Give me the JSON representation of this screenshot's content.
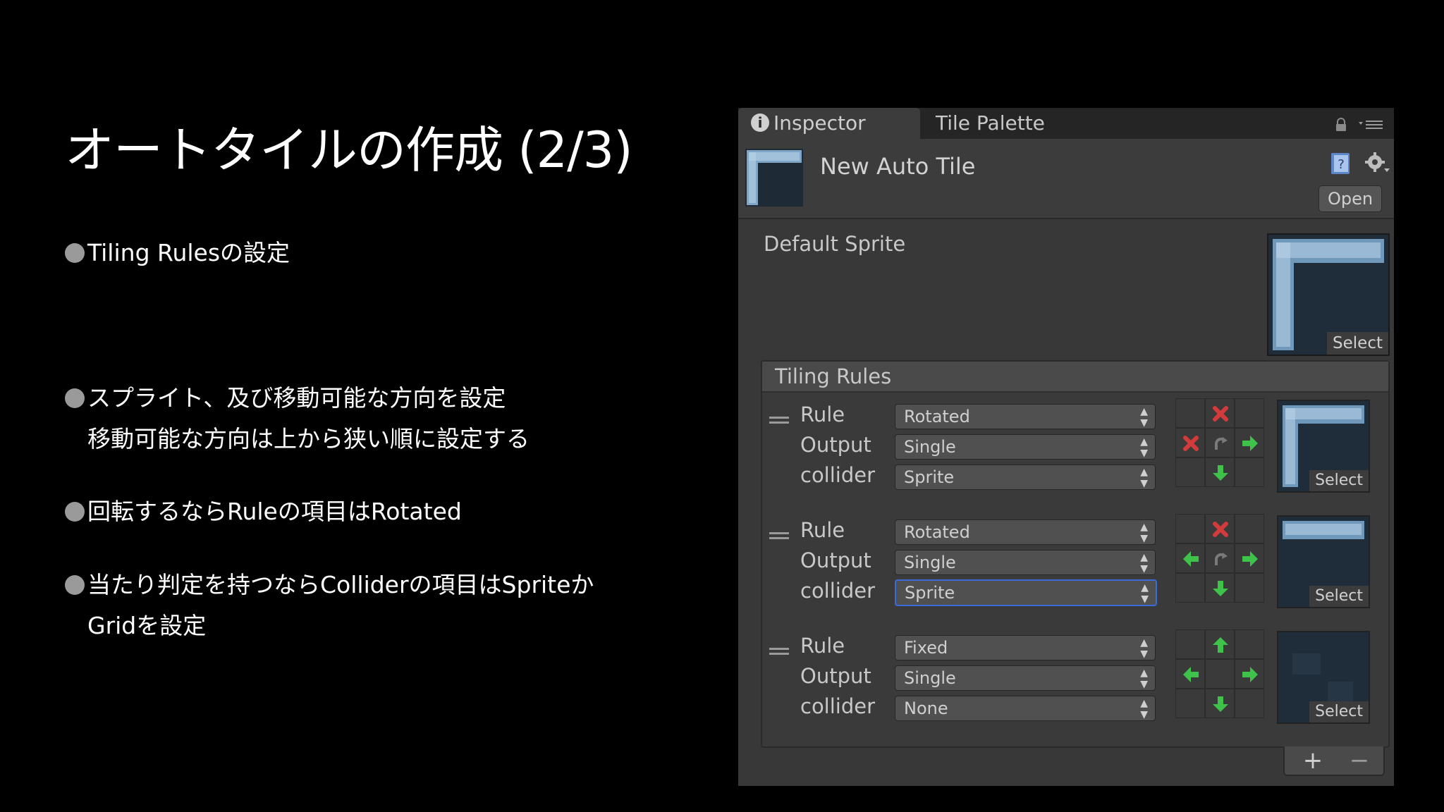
{
  "slide": {
    "title": "オートタイルの作成 (2/3)",
    "bullets": [
      {
        "line1": "Tiling Rulesの設定",
        "line2": ""
      },
      {
        "line1": "スプライト、及び移動可能な方向を設定",
        "line2": "移動可能な方向は上から狭い順に設定する"
      },
      {
        "line1": "回転するならRuleの項目はRotated",
        "line2": ""
      },
      {
        "line1": "当たり判定を持つならColliderの項目はSpriteか",
        "line2": "Gridを設定"
      }
    ]
  },
  "inspector": {
    "tabs": {
      "inspector": "Inspector",
      "tile_palette": "Tile Palette"
    },
    "asset_name": "New Auto Tile",
    "open_label": "Open",
    "default_sprite_label": "Default Sprite",
    "select_label": "Select",
    "tiling_rules_label": "Tiling Rules",
    "field_labels": {
      "rule": "Rule",
      "output": "Output",
      "collider": "collider"
    },
    "rules": [
      {
        "rule": "Rotated",
        "output": "Single",
        "collider": "Sprite",
        "collider_focused": false,
        "neighbors": [
          "",
          "x",
          "",
          "x",
          "rotate",
          "right",
          "",
          "down",
          ""
        ],
        "sprite": "corner"
      },
      {
        "rule": "Rotated",
        "output": "Single",
        "collider": "Sprite",
        "collider_focused": true,
        "neighbors": [
          "",
          "x",
          "",
          "left",
          "rotate",
          "right",
          "",
          "down",
          ""
        ],
        "sprite": "top"
      },
      {
        "rule": "Fixed",
        "output": "Single",
        "collider": "None",
        "collider_focused": false,
        "neighbors": [
          "",
          "up",
          "",
          "left",
          "",
          "right",
          "",
          "down",
          ""
        ],
        "sprite": "plain"
      }
    ],
    "add_button": "+",
    "remove_button": "−",
    "colors": {
      "arrow_green": "#3ec24a",
      "x_red": "#d23b3b",
      "focus_blue": "#3a6bd6",
      "panel": "#383838"
    }
  }
}
